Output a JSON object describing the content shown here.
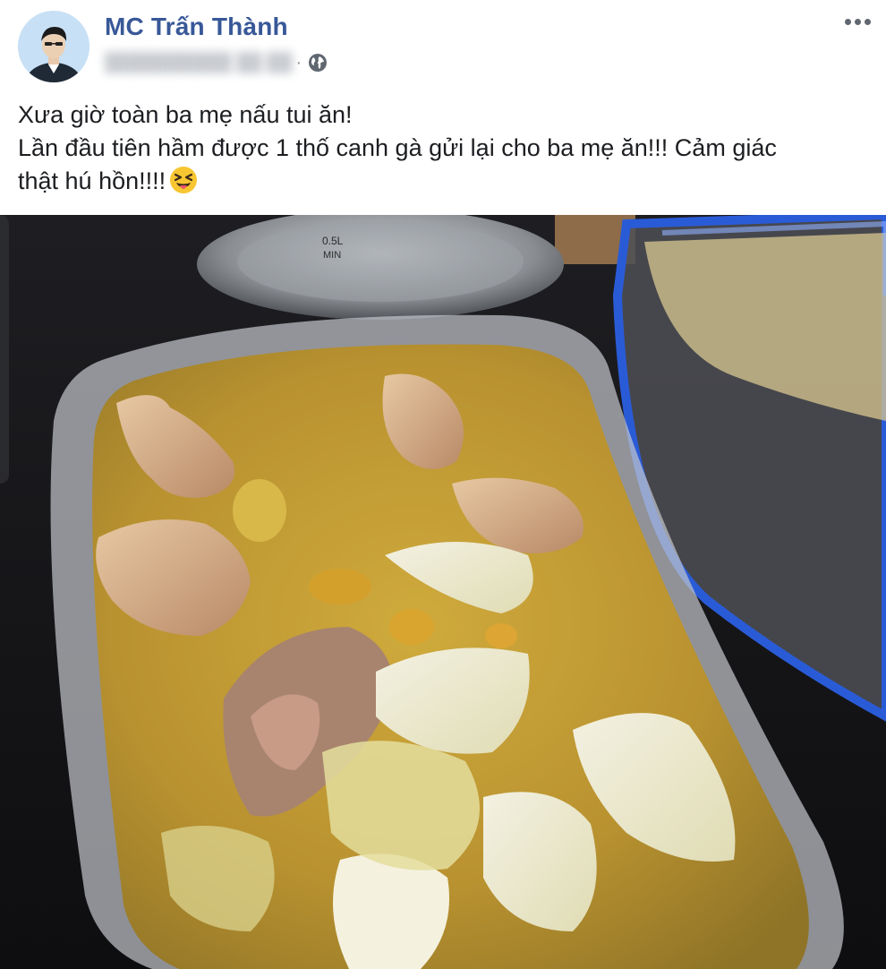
{
  "post": {
    "author": "MC Trấn Thành",
    "timestamp": "██████████ ██:██",
    "separator": "·",
    "privacy_icon": "globe-icon",
    "more_icon": "more-options-icon",
    "lines": [
      "Xưa giờ toàn ba mẹ nấu tui ăn!",
      "Lần đầu tiên hầm được 1 thố canh gà gửi lại cho ba mẹ ăn!!! Cảm giác",
      "thật hú hồn!!!!"
    ],
    "emoji": "squinting-face-with-tongue-icon"
  },
  "photo": {
    "pot_label_capacity": "0.5L",
    "pot_label_min": "MIN"
  },
  "colors": {
    "author": "#385898",
    "text": "#1c1e21",
    "meta": "#8d949e",
    "lid_blue": "#2a5bd7",
    "broth": "#c9a33a"
  }
}
